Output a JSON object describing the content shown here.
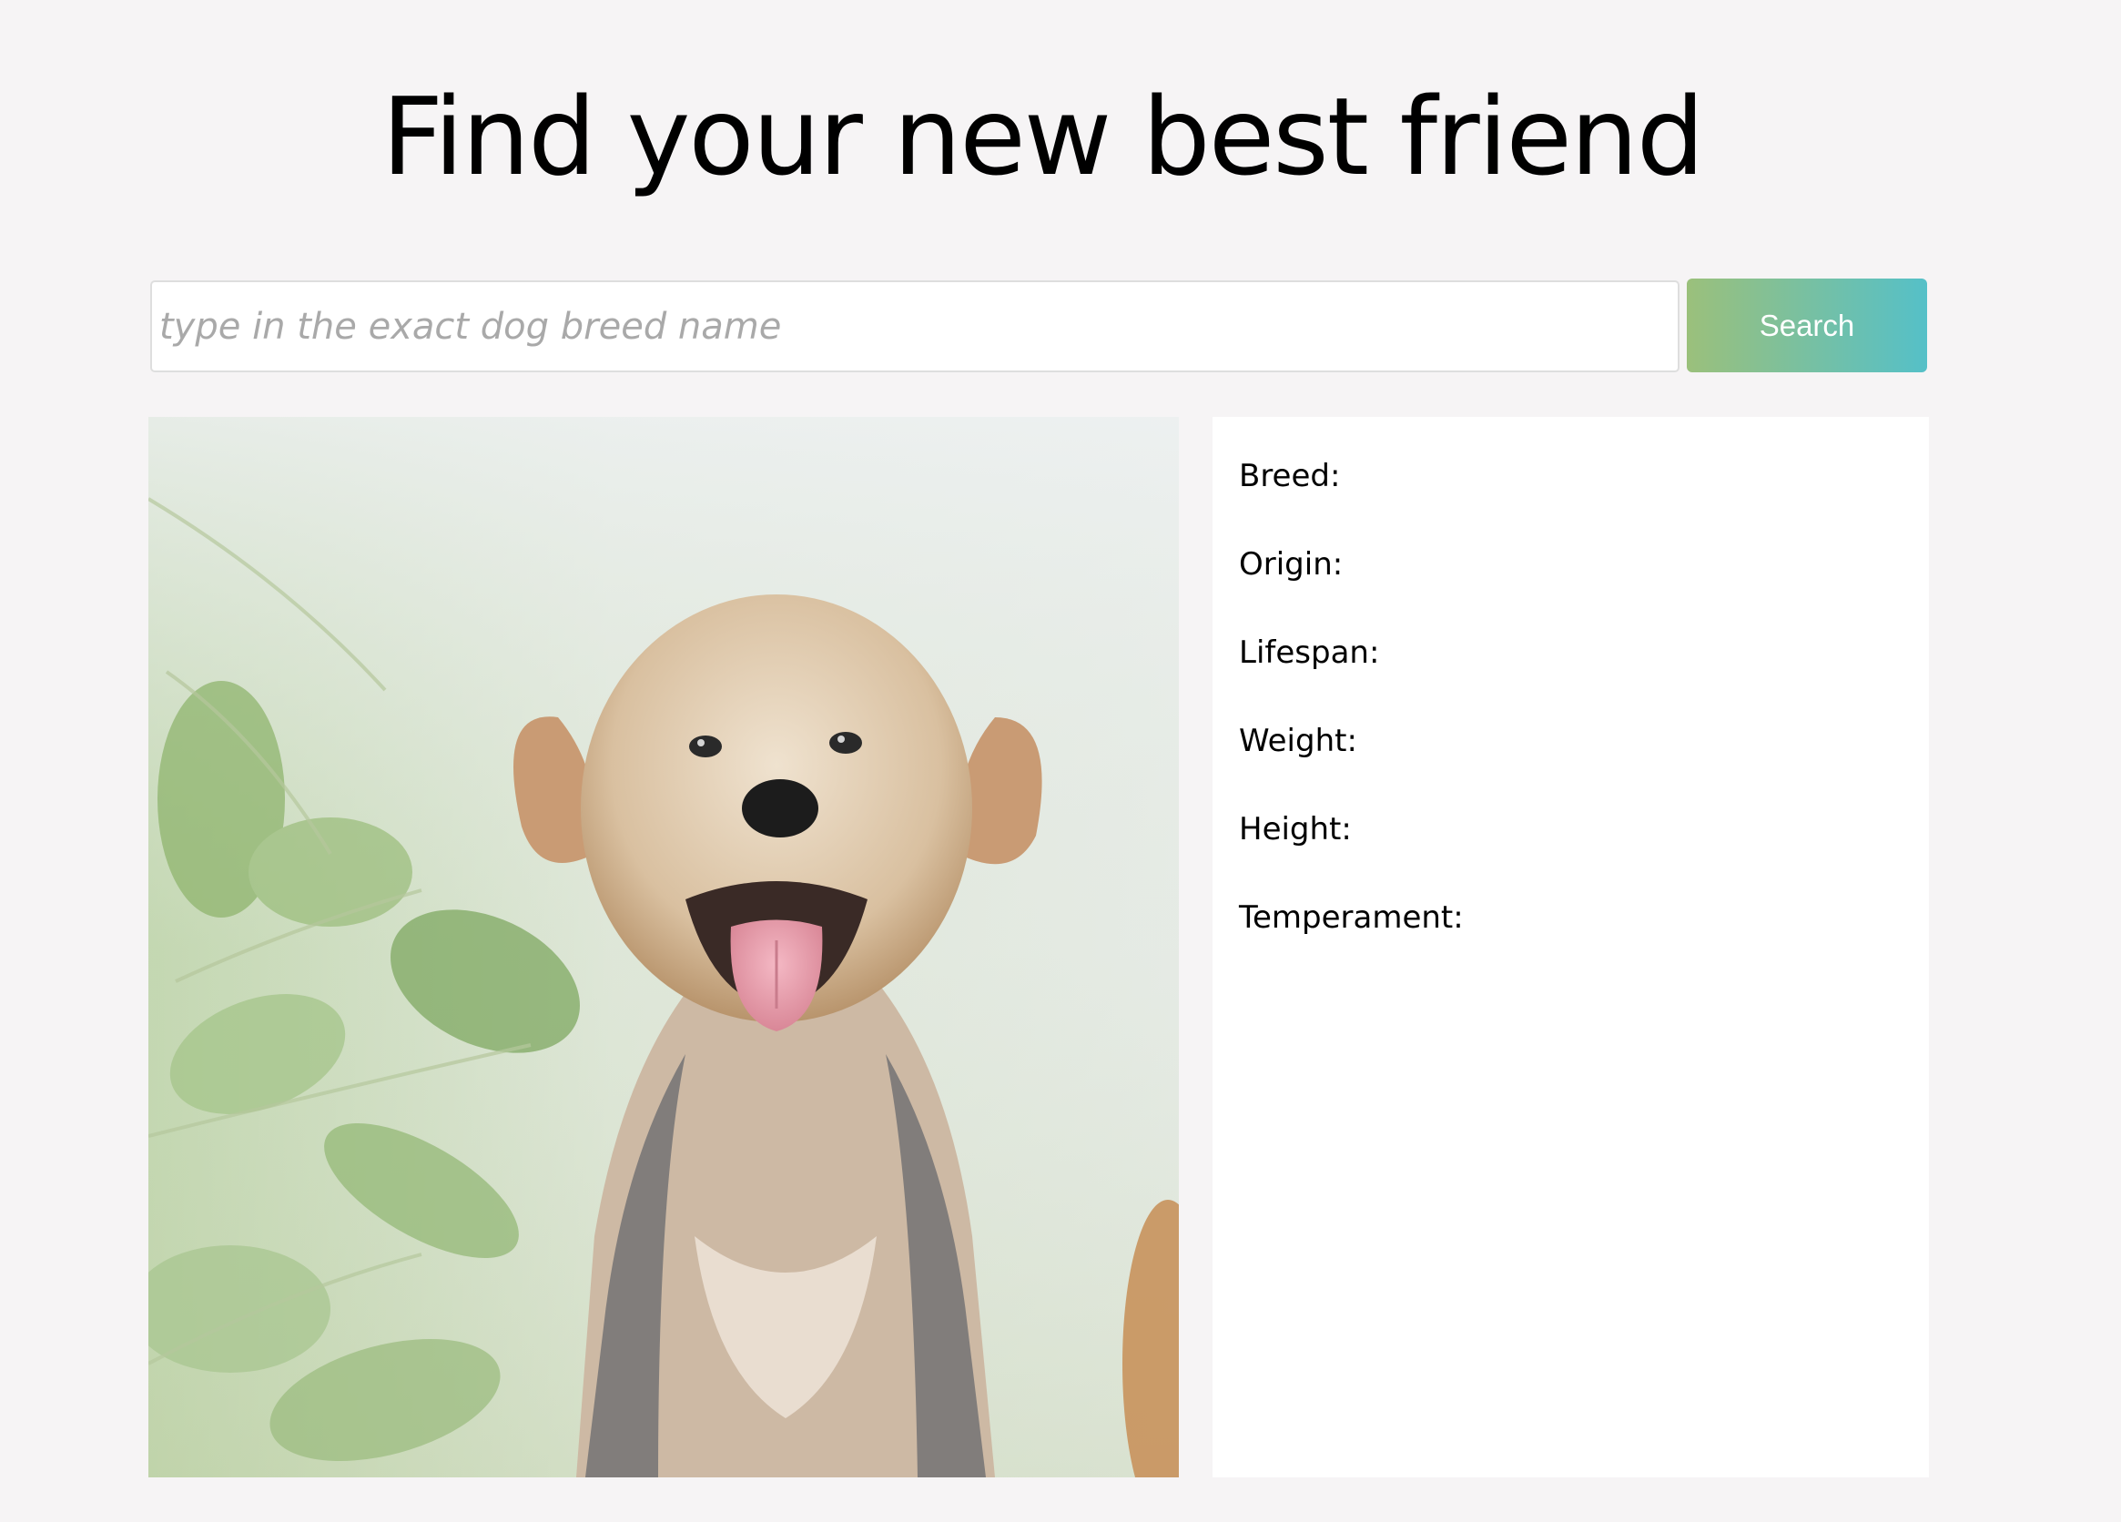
{
  "header": {
    "title": "Find your new best friend"
  },
  "search": {
    "placeholder": "type in the exact dog breed name",
    "value": "",
    "button_label": "Search",
    "button_gradient": [
      "#9bc07b",
      "#55c0c8"
    ]
  },
  "photo": {
    "subject": "dog-photo"
  },
  "info": {
    "fields": [
      {
        "label": "Breed:",
        "value": ""
      },
      {
        "label": "Origin:",
        "value": ""
      },
      {
        "label": "Lifespan:",
        "value": ""
      },
      {
        "label": "Weight:",
        "value": ""
      },
      {
        "label": "Height:",
        "value": ""
      },
      {
        "label": "Temperament:",
        "value": ""
      }
    ]
  },
  "colors": {
    "background": "#f6f4f5",
    "panel": "#ffffff"
  }
}
